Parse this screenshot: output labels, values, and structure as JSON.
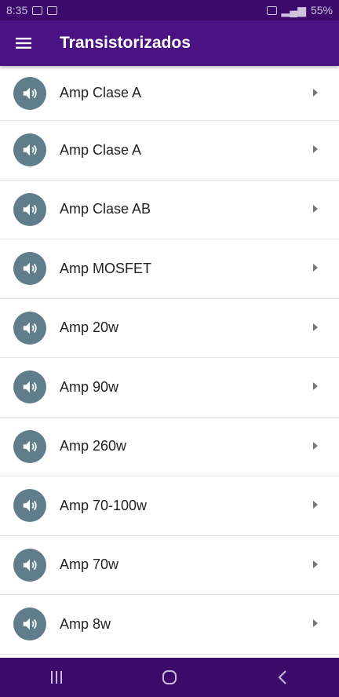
{
  "status_bar": {
    "time": "8:35",
    "battery": "55%"
  },
  "app_bar": {
    "title": "Transistorizados",
    "menu_icon": "hamburger-menu-icon"
  },
  "list": {
    "icon": "speaker-volume-icon",
    "items": [
      {
        "label": "Amp Clase A"
      },
      {
        "label": "Amp Clase A"
      },
      {
        "label": "Amp Clase AB"
      },
      {
        "label": "Amp MOSFET"
      },
      {
        "label": "Amp 20w"
      },
      {
        "label": "Amp 90w"
      },
      {
        "label": "Amp 260w"
      },
      {
        "label": "Amp 70-100w"
      },
      {
        "label": "Amp 70w"
      },
      {
        "label": "Amp 8w"
      }
    ]
  },
  "nav_bar": {
    "buttons": [
      "recent-apps-icon",
      "home-icon",
      "back-icon"
    ]
  },
  "colors": {
    "app_bar": "#4a1282",
    "status_bar": "#3b0a6b",
    "avatar": "#607d8b"
  }
}
